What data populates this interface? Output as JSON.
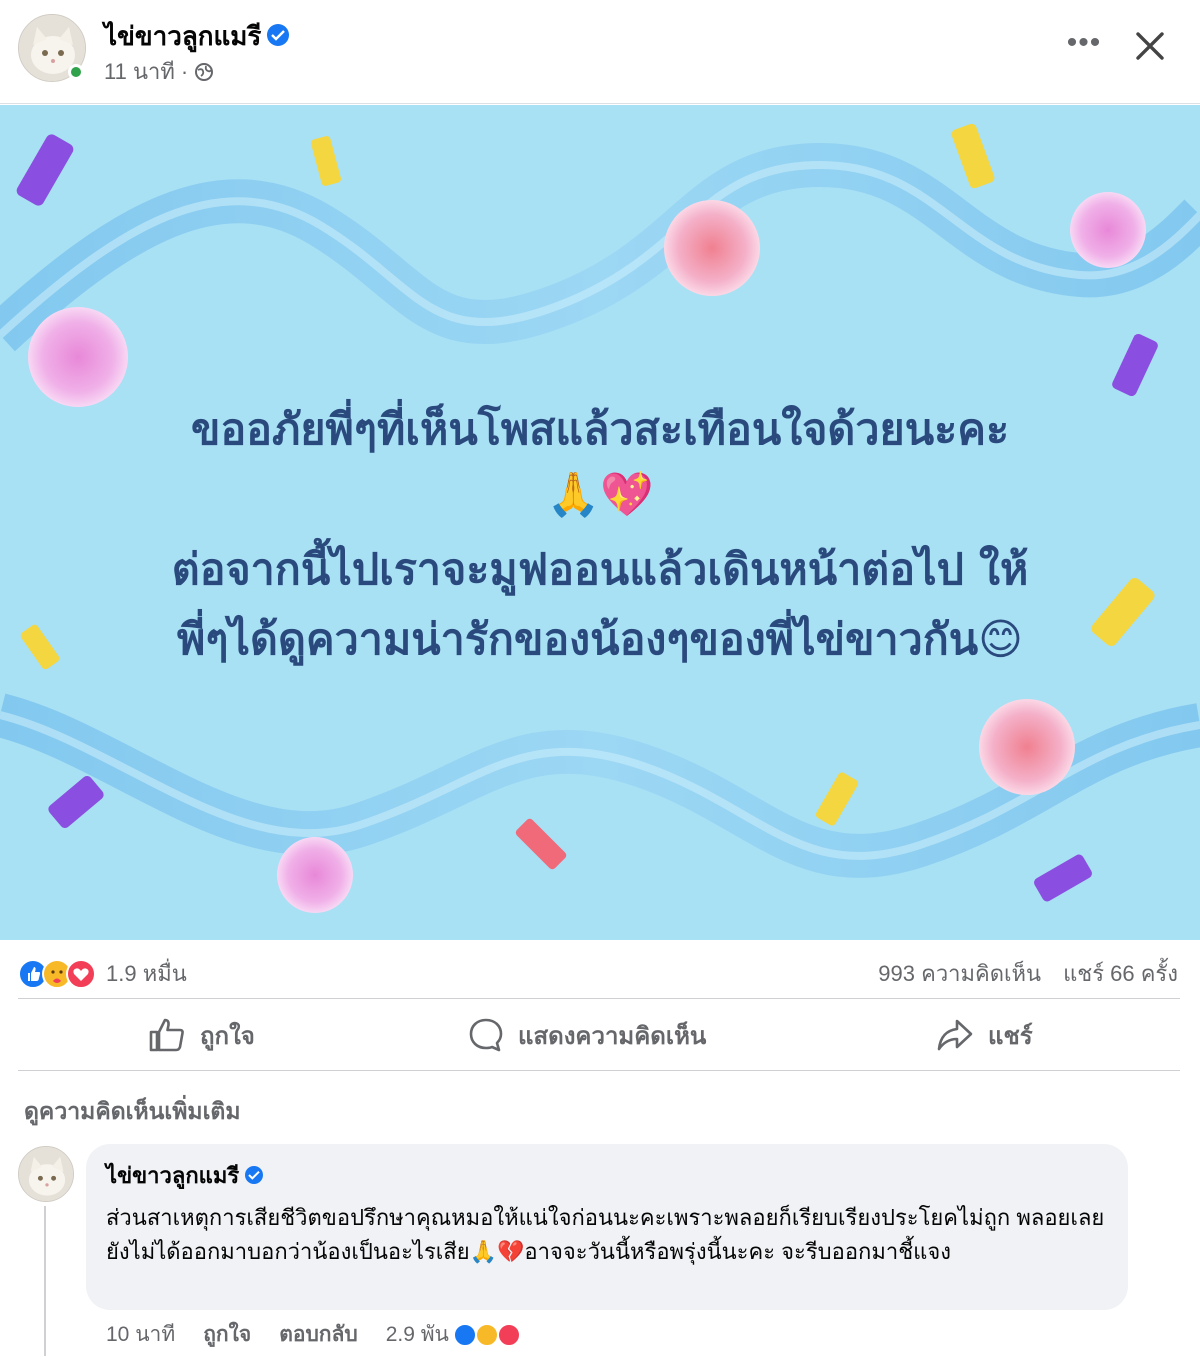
{
  "post": {
    "author": "ไข่ขาวลูกแมรี",
    "time": "11 นาที",
    "separator": "·",
    "more_label": "•••",
    "image_text": {
      "line1": "ขออภัยพี่ๆที่เห็นโพสแล้วสะเทือนใจด้วยนะคะ",
      "line2": "🙏💖",
      "line3": "ต่อจากนี้ไปเราจะมูฟออนแล้วเดินหน้าต่อไป ให้",
      "line4": "พี่ๆได้ดูความน่ารักของน้องๆของพี่ไข่ขาวกัน😊"
    },
    "image_colors": {
      "background": "#a8e0f4",
      "text": "#2a4a7e"
    }
  },
  "stats": {
    "reaction_count": "1.9 หมื่น",
    "comments": "993 ความคิดเห็น",
    "shares": "แชร์ 66 ครั้ง",
    "reaction_icons": [
      "like-icon",
      "care-icon",
      "love-icon"
    ]
  },
  "actions": {
    "like": "ถูกใจ",
    "comment": "แสดงความคิดเห็น",
    "share": "แชร์"
  },
  "comments_section": {
    "more_label": "ดูความคิดเห็นเพิ่มเติม"
  },
  "comment": {
    "author": "ไข่ขาวลูกแมรี",
    "text": "ส่วนสาเหตุการเสียชีวิตขอปรึกษาคุณหมอให้แน่ใจก่อนนะคะเพราะพลอยก็เรียบเรียงประโยคไม่ถูก พลอยเลยยังไม่ได้ออกมาบอกว่าน้องเป็นอะไรเสีย🙏💔อาจจะวันนี้หรือพรุ่งนี้นะคะ จะรีบออกมาชี้แจง",
    "time": "10 นาที",
    "like_label": "ถูกใจ",
    "reply_label": "ตอบกลับ",
    "reaction_count": "2.9 พัน"
  },
  "colors": {
    "accent": "#1877f2",
    "secondary_text": "#65676b",
    "bubble": "#f0f2f5"
  }
}
